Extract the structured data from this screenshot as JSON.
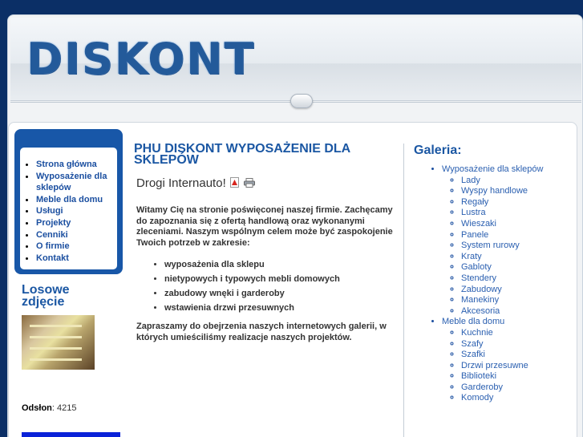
{
  "header": {
    "logo_text": "DISKONT"
  },
  "menu": {
    "items": [
      {
        "label": "Strona główna"
      },
      {
        "label": "Wyposażenie dla sklepów"
      },
      {
        "label": "Meble dla domu"
      },
      {
        "label": "Usługi"
      },
      {
        "label": "Projekty"
      },
      {
        "label": "Cenniki"
      },
      {
        "label": "O firmie"
      },
      {
        "label": "Kontakt"
      }
    ]
  },
  "random": {
    "title": "Losowe zdjęcie"
  },
  "counter": {
    "label": "Odsłon",
    "value": ": 4215"
  },
  "main": {
    "title": "PHU DISKONT WYPOSAŻENIE DLA SKLEPÓW",
    "subtitle": "Drogi Internauto!",
    "intro": "Witamy Cię na stronie poświęconej naszej firmie. Zachęcamy do zapoznania się z ofertą handlową oraz wykonanymi zleceniami. Naszym wspólnym celem może być zaspokojenie Twoich potrzeb w zakresie:",
    "services": [
      "wyposażenia dla sklepu",
      "nietypowych i typowych mebli domowych",
      "zabudowy wnęki i garderoby",
      "wstawienia drzwi przesuwnych"
    ],
    "outro": "Zapraszamy do obejrzenia naszych internetowych galerii, w których umieściliśmy realizacje naszych projektów."
  },
  "gallery": {
    "title": "Galeria:",
    "groups": [
      {
        "label": "Wyposażenie dla sklepów",
        "items": [
          "Lady",
          "Wyspy handlowe",
          "Regały",
          "Lustra",
          "Wieszaki",
          "Panele",
          "System rurowy",
          "Kraty",
          "Gabloty",
          "Stendery",
          "Zabudowy",
          "Manekiny",
          "Akcesoria"
        ]
      },
      {
        "label": "Meble dla domu",
        "items": [
          "Kuchnie",
          "Szafy",
          "Szafki",
          "Drzwi przesuwne",
          "Biblioteki",
          "Garderoby",
          "Komody"
        ]
      }
    ]
  },
  "icons": {
    "pdf": "pdf-icon",
    "print": "print-icon"
  },
  "colors": {
    "brand_blue": "#1857a8",
    "title_blue": "#1b57a3",
    "background": "#0b2f66"
  }
}
